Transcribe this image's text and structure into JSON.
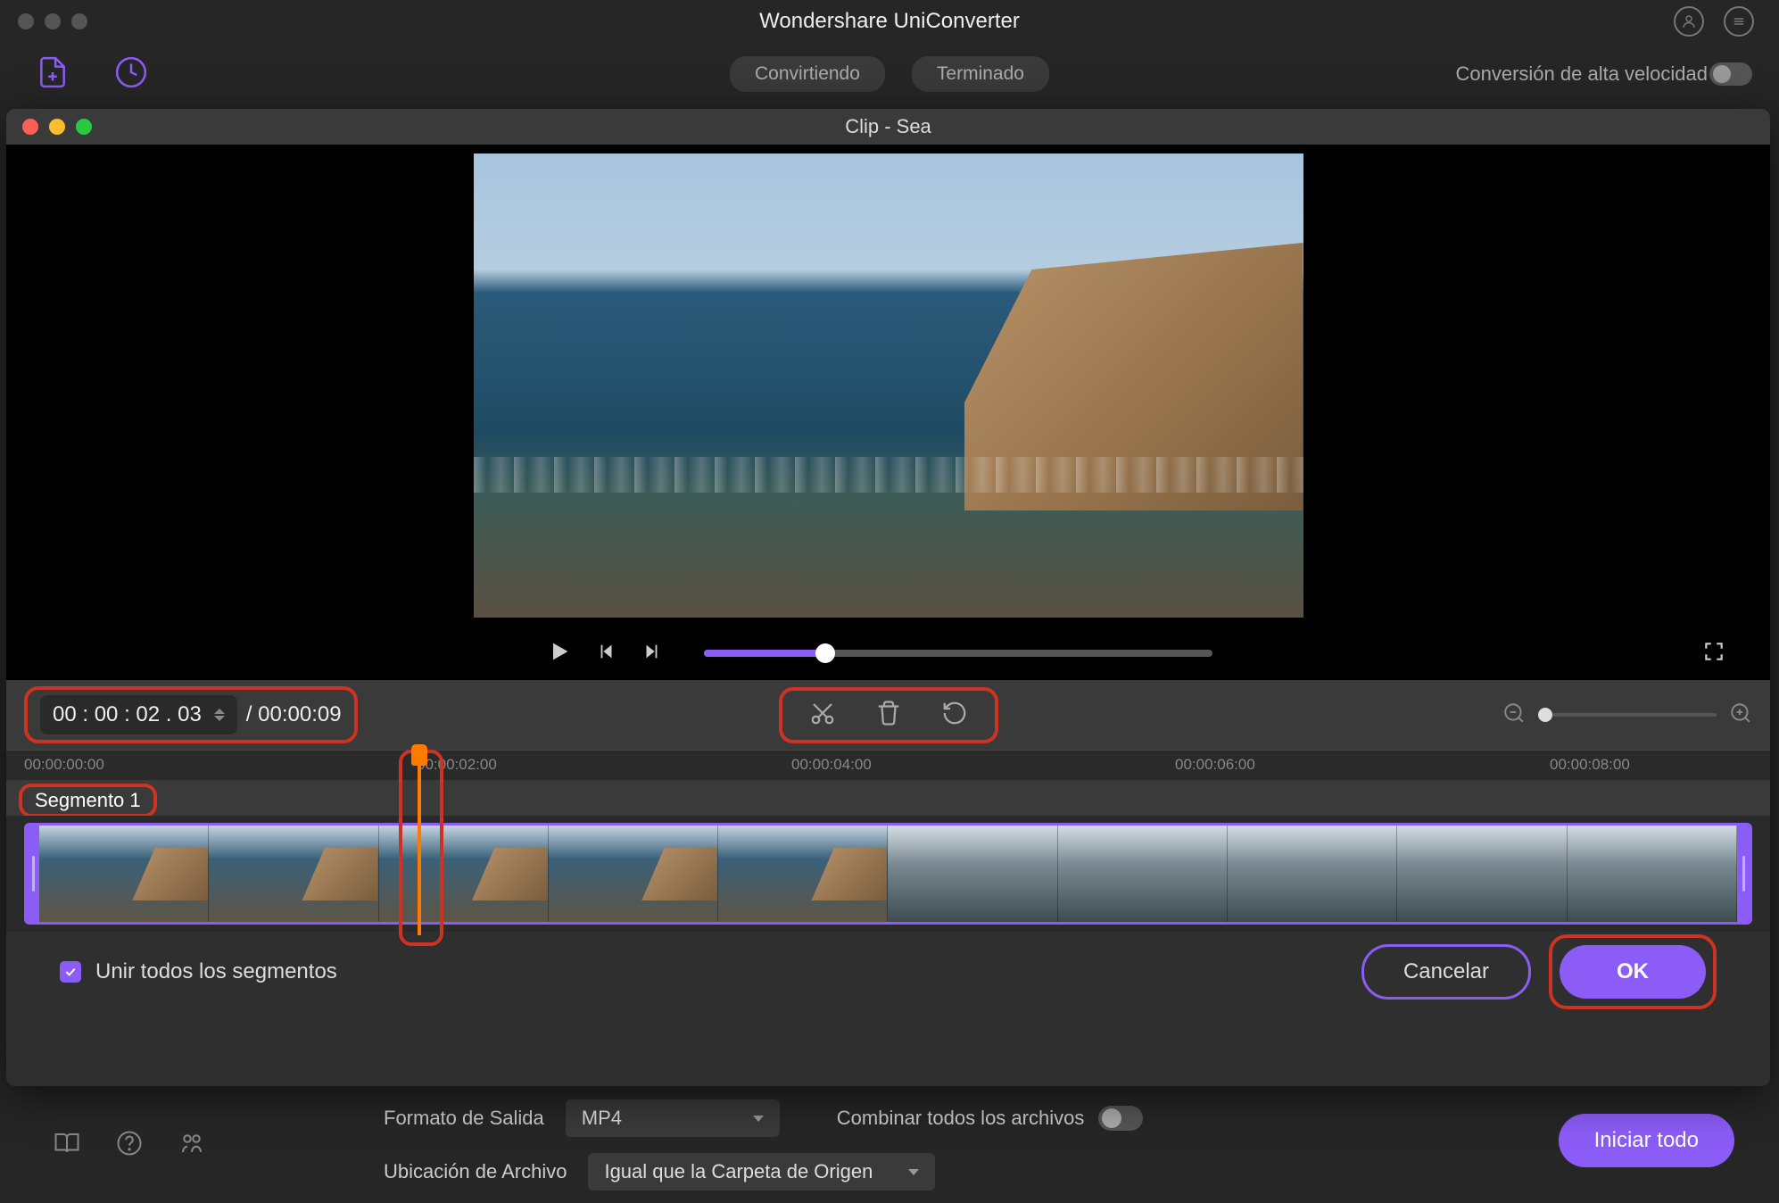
{
  "app": {
    "title": "Wondershare UniConverter"
  },
  "mainTabs": {
    "tab1": "Convirtiendo",
    "tab2": "Terminado"
  },
  "mainRight": "Conversión de alta velocidad",
  "modal": {
    "title": "Clip - Sea"
  },
  "timecode": {
    "current": "00 : 00 : 02 . 03",
    "total": "/ 00:00:09"
  },
  "ruler": {
    "t0": "00:00:00:00",
    "t1": "00:00:02:00",
    "t2": "00:00:04:00",
    "t3": "00:00:06:00",
    "t4": "00:00:08:00"
  },
  "segment": {
    "label": "Segmento 1"
  },
  "merge": {
    "label": "Unir todos los segmentos"
  },
  "buttons": {
    "cancel": "Cancelar",
    "ok": "OK",
    "start": "Iniciar todo"
  },
  "bottom": {
    "outputLabel": "Formato de Salida",
    "outputValue": "MP4",
    "locationLabel": "Ubicación de Archivo",
    "locationValue": "Igual que la Carpeta de Origen",
    "combineLabel": "Combinar todos los archivos"
  }
}
